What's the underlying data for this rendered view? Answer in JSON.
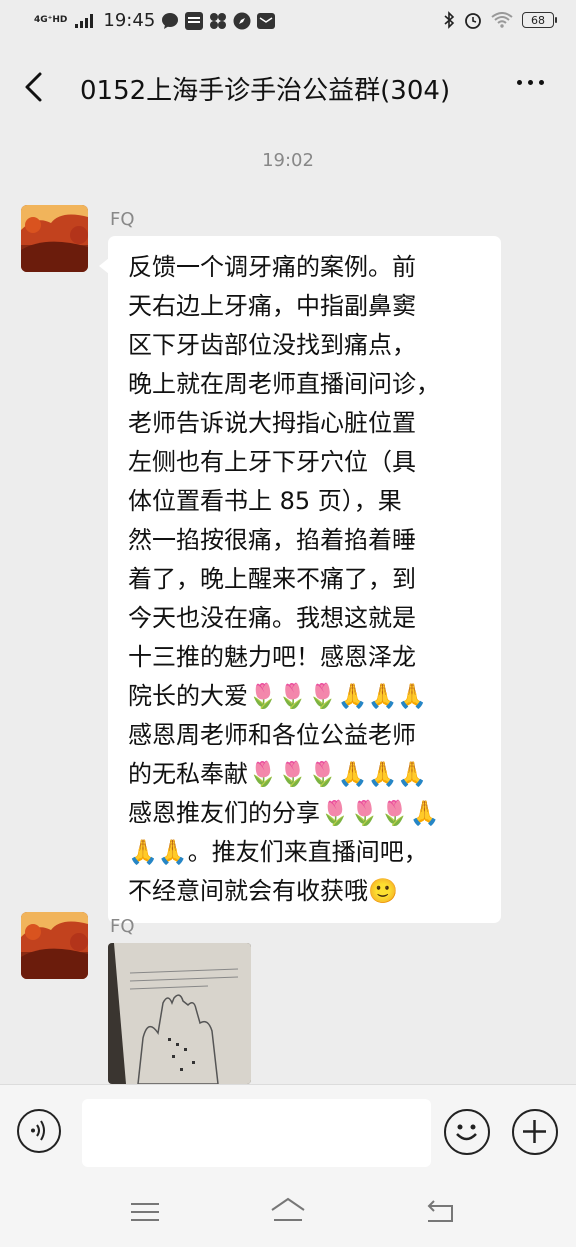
{
  "status_bar": {
    "network": "4G⁺HD",
    "time": "19:45",
    "battery": "68",
    "left_icons": [
      "message-icon",
      "toutiao-icon",
      "pinwheel-icon",
      "compass-icon",
      "mail-icon"
    ],
    "right_icons": [
      "bluetooth-icon",
      "alarm-icon",
      "wifi-icon",
      "battery-icon"
    ]
  },
  "header": {
    "title": "0152上海手诊手治公益群(304)",
    "back_icon": "back-arrow-icon",
    "more_icon": "more-dots-icon"
  },
  "chat": {
    "timestamp": "19:02",
    "messages": [
      {
        "sender": "FQ",
        "type": "text",
        "lines": [
          "反馈一个调牙痛的案例。前",
          "天右边上牙痛，中指副鼻窦",
          "区下牙齿部位没找到痛点，",
          "晚上就在周老师直播间问诊，",
          "老师告诉说大拇指心脏位置",
          "左侧也有上牙下牙穴位（具",
          "体位置看书上 85 页），果",
          "然一掐按很痛，掐着掐着睡",
          "着了，晚上醒来不痛了，到",
          "今天也没在痛。我想这就是",
          "十三推的魅力吧！感恩泽龙",
          "院长的大爱🌷🌷🌷🙏🙏🙏",
          "感恩周老师和各位公益老师",
          "的无私奉献🌷🌷🌷🙏🙏🙏",
          "感恩推友们的分享🌷🌷🌷🙏",
          "🙏🙏。推友们来直播间吧，",
          "不经意间就会有收获哦🙂"
        ]
      },
      {
        "sender": "FQ",
        "type": "image",
        "image_text": "手掌图"
      }
    ]
  },
  "input_bar": {
    "voice_icon": "voice-icon",
    "placeholder": "",
    "emoji_icon": "emoji-icon",
    "plus_icon": "plus-icon"
  },
  "nav_bar": {
    "icons": [
      "menu-icon",
      "home-icon",
      "back-icon"
    ]
  }
}
